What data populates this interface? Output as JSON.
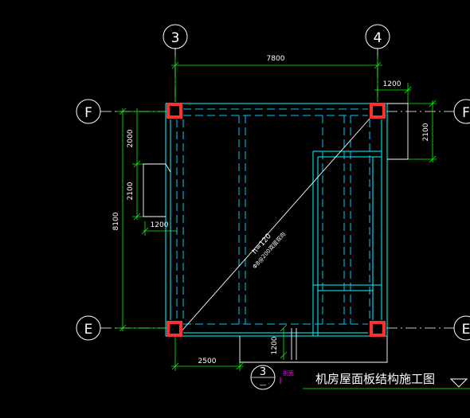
{
  "grid_axes": {
    "top_left": "3",
    "top_right": "4",
    "left_top": "F",
    "left_bottom": "E",
    "right_top": "F",
    "right_bottom": "E"
  },
  "dimensions": {
    "overall_width": "7800",
    "overall_height": "8100",
    "top_right_offset": "1200",
    "right_vertical": "2100",
    "left_upper": "2000",
    "left_middle": "2100",
    "left_notch": "1200",
    "bottom_left": "2500",
    "bottom_notch": "1200"
  },
  "slab_note": {
    "line1": "h=120",
    "line2": "Φ8@200双层双向"
  },
  "section_mark": {
    "number": "3",
    "sheet": "—",
    "tag": "剖面"
  },
  "drawing_title": "机房屋面板结构施工图",
  "colors": {
    "background": "#000000",
    "axis": "#ffffff",
    "dimension": "#00ff00",
    "wall": "#00ffff",
    "beam_dashed": "#00ccff",
    "column": "#ff3030",
    "slab_line": "#ffffff",
    "section_tag": "#ff00ff"
  }
}
